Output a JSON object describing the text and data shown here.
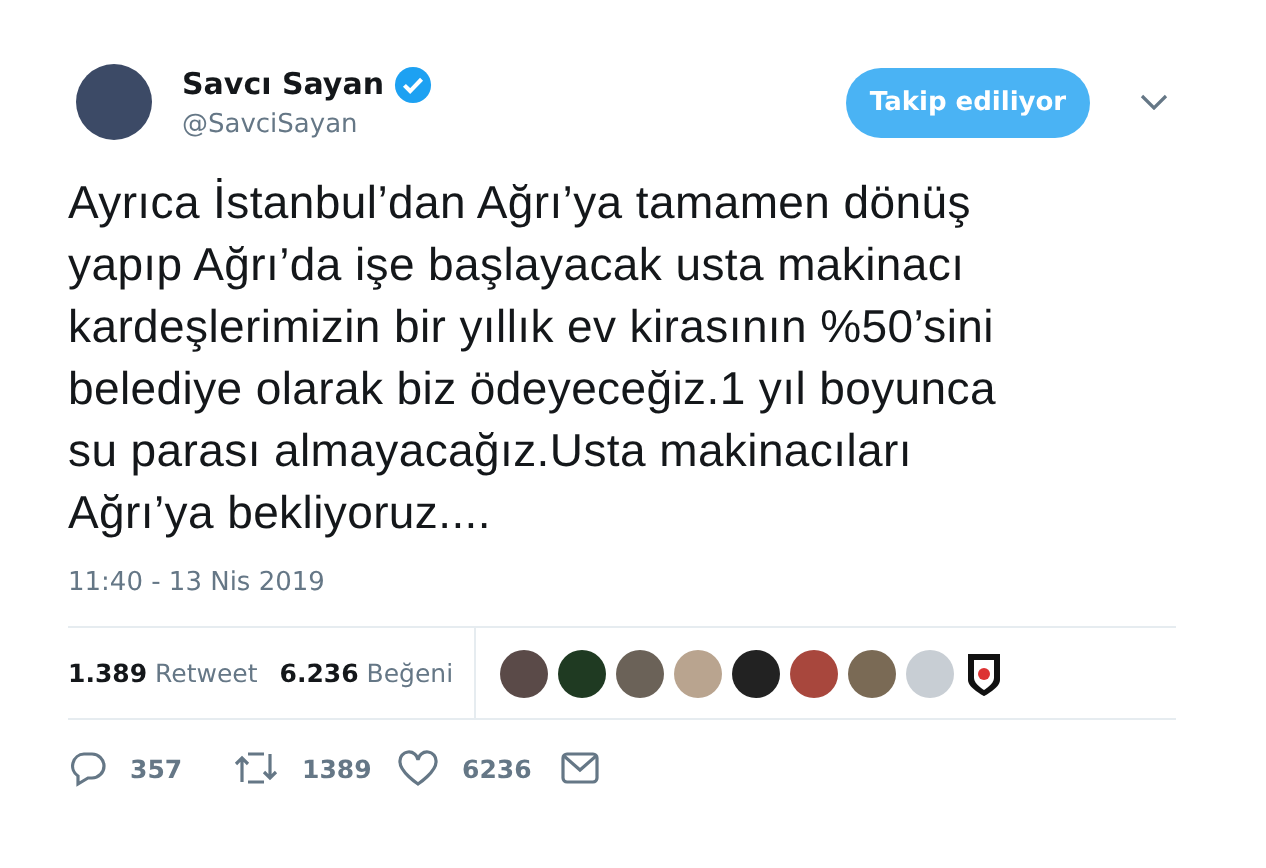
{
  "author": {
    "name": "Savcı Sayan",
    "verified": true,
    "handle": "@SavciSayan"
  },
  "follow_button": {
    "label": "Takip ediliyor"
  },
  "tweet": {
    "lines": [
      "Ayrıca İstanbul’dan Ağrı’ya tamamen dönüş",
      "yapıp Ağrı’da işe başlayacak usta makinacı",
      "kardeşlerimizin bir yıllık ev kirasının %50’sini",
      "belediye olarak biz ödeyeceğiz.1 yıl boyunca",
      "su parası almayacağız.Usta makinacıları",
      "Ağrı’ya  bekliyoruz...."
    ]
  },
  "timestamp": "11:40 - 13 Nis 2019",
  "stats": [
    {
      "count": "1.389",
      "label": "Retweet"
    },
    {
      "count": "6.236",
      "label": "Beğeni"
    }
  ],
  "likers": [
    {
      "kind": "photo"
    },
    {
      "kind": "photo"
    },
    {
      "kind": "photo"
    },
    {
      "kind": "photo"
    },
    {
      "kind": "photo"
    },
    {
      "kind": "photo"
    },
    {
      "kind": "photo"
    },
    {
      "kind": "photo"
    },
    {
      "kind": "logo"
    }
  ],
  "actions": [
    {
      "kind": "reply",
      "count": "357"
    },
    {
      "kind": "retweet",
      "count": "1389"
    },
    {
      "kind": "like",
      "count": "6236"
    },
    {
      "kind": "message"
    }
  ]
}
